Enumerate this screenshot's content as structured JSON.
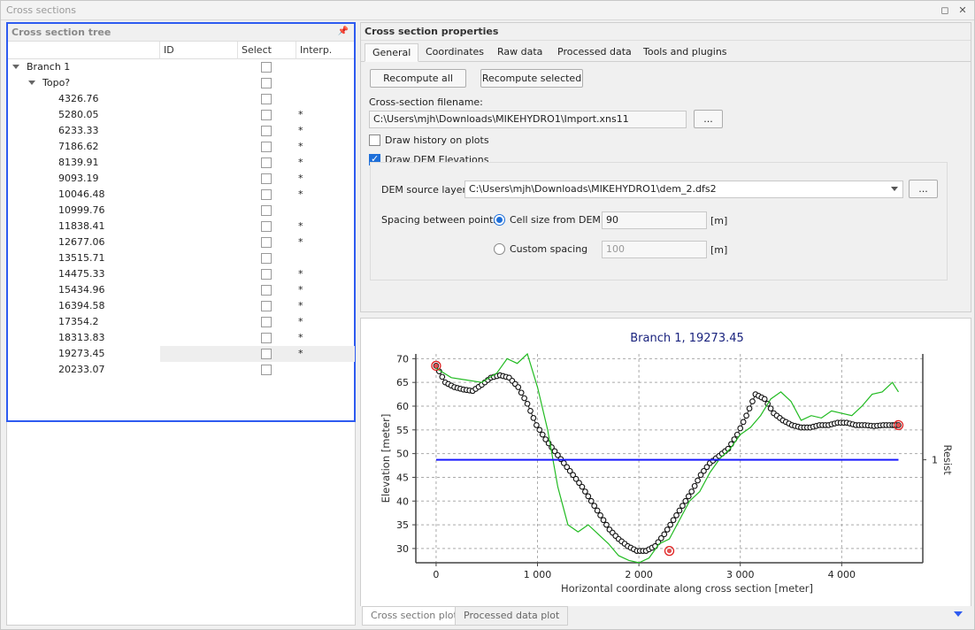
{
  "window": {
    "title": "Cross sections",
    "restore_glyph": "◻",
    "close_glyph": "✕"
  },
  "tree": {
    "title": "Cross section tree",
    "columns": [
      "ID",
      "Select",
      "Interp."
    ],
    "branch": "Branch 1",
    "topo": "Topo?",
    "rows": [
      {
        "id": "4326.76",
        "interp": ""
      },
      {
        "id": "5280.05",
        "interp": "*"
      },
      {
        "id": "6233.33",
        "interp": "*"
      },
      {
        "id": "7186.62",
        "interp": "*"
      },
      {
        "id": "8139.91",
        "interp": "*"
      },
      {
        "id": "9093.19",
        "interp": "*"
      },
      {
        "id": "10046.48",
        "interp": "*"
      },
      {
        "id": "10999.76",
        "interp": ""
      },
      {
        "id": "11838.41",
        "interp": "*"
      },
      {
        "id": "12677.06",
        "interp": "*"
      },
      {
        "id": "13515.71",
        "interp": ""
      },
      {
        "id": "14475.33",
        "interp": "*"
      },
      {
        "id": "15434.96",
        "interp": "*"
      },
      {
        "id": "16394.58",
        "interp": "*"
      },
      {
        "id": "17354.2",
        "interp": "*"
      },
      {
        "id": "18313.83",
        "interp": "*"
      },
      {
        "id": "19273.45",
        "interp": "*"
      },
      {
        "id": "20233.07",
        "interp": ""
      }
    ]
  },
  "props": {
    "title": "Cross section properties",
    "tabs": [
      "General",
      "Coordinates",
      "Raw data",
      "Processed data",
      "Tools and plugins"
    ],
    "recompute_all": "Recompute all",
    "recompute_selected": "Recompute selected",
    "filename_label": "Cross-section filename:",
    "filename_value": "C:\\Users\\mjh\\Downloads\\MIKEHYDRO1\\Import.xns11",
    "browse": "...",
    "draw_history": "Draw history on plots",
    "draw_dem": "Draw DEM Elevations",
    "dem_source_label": "DEM source layer",
    "dem_source_value": "C:\\Users\\mjh\\Downloads\\MIKEHYDRO1\\dem_2.dfs2",
    "spacing_label": "Spacing between points",
    "cell_size_label": "Cell size from DEM",
    "cell_size_value": "90",
    "custom_label": "Custom spacing",
    "custom_value": "100",
    "unit": "[m]"
  },
  "chart_data": {
    "type": "line",
    "title": "Branch 1, 19273.45",
    "xlabel": "Horizontal coordinate along cross section [meter]",
    "ylabel": "Elevation [meter]",
    "y2label": "Resist",
    "y2tick": "1",
    "xlim": [
      -200,
      4800
    ],
    "ylim": [
      27,
      71
    ],
    "xticks": [
      0,
      1000,
      2000,
      3000,
      4000
    ],
    "xtick_labels": [
      "0",
      "1 000",
      "2 000",
      "3 000",
      "4 000"
    ],
    "yticks": [
      30,
      35,
      40,
      45,
      50,
      55,
      60,
      65,
      70
    ],
    "grid": true,
    "series": [
      {
        "color": "#000000",
        "style": "circle-markers",
        "x": [
          0,
          90,
          180,
          270,
          360,
          450,
          540,
          630,
          720,
          810,
          900,
          990,
          1080,
          1170,
          1260,
          1350,
          1440,
          1530,
          1620,
          1710,
          1800,
          1890,
          1980,
          2070,
          2160,
          2250,
          2340,
          2430,
          2520,
          2610,
          2700,
          2790,
          2880,
          2970,
          3060,
          3150,
          3240,
          3330,
          3420,
          3510,
          3600,
          3690,
          3780,
          3870,
          3960,
          4050,
          4140,
          4230,
          4320,
          4410,
          4500,
          4560
        ],
        "y": [
          68.5,
          65,
          64,
          63.5,
          63.2,
          64.5,
          66,
          66.5,
          66,
          64,
          60.5,
          56,
          53,
          50.5,
          48,
          45.5,
          43,
          40,
          37,
          34,
          32,
          30.5,
          29.5,
          29.5,
          30.5,
          33,
          36,
          39,
          42,
          45.5,
          48,
          49.5,
          51,
          54,
          58,
          62.5,
          61.5,
          58.5,
          57,
          56,
          55.5,
          55.5,
          56,
          56,
          56.5,
          56.5,
          56,
          56,
          55.8,
          56,
          56,
          56
        ]
      },
      {
        "color": "#22bb22",
        "style": "line",
        "x": [
          0,
          150,
          300,
          450,
          600,
          700,
          800,
          900,
          1000,
          1100,
          1200,
          1300,
          1400,
          1500,
          1600,
          1700,
          1800,
          1900,
          2000,
          2100,
          2200,
          2300,
          2400,
          2500,
          2600,
          2700,
          2800,
          2900,
          3000,
          3100,
          3200,
          3300,
          3400,
          3500,
          3600,
          3700,
          3800,
          3900,
          4000,
          4100,
          4200,
          4300,
          4400,
          4500,
          4560
        ],
        "y": [
          68,
          66,
          65.5,
          65,
          67,
          70,
          69,
          71,
          64,
          55,
          43,
          35,
          33.5,
          35,
          33,
          31,
          28.5,
          27.5,
          27,
          28,
          31,
          32,
          36,
          40,
          42,
          46,
          49,
          51,
          54,
          55.5,
          58,
          61.5,
          63,
          61,
          57,
          58,
          57.5,
          59,
          58.5,
          58,
          60,
          62.5,
          63,
          65,
          63
        ]
      },
      {
        "color": "#1a1aff",
        "style": "flat-line",
        "x": [
          0,
          4560
        ],
        "y": [
          48.7,
          48.7
        ]
      }
    ],
    "highlighted_points": [
      {
        "x": 0,
        "y": 68.5
      },
      {
        "x": 2300,
        "y": 29.5
      },
      {
        "x": 4560,
        "y": 56
      }
    ]
  },
  "bottom_tabs": [
    "Cross section plot",
    "Processed data plot"
  ]
}
